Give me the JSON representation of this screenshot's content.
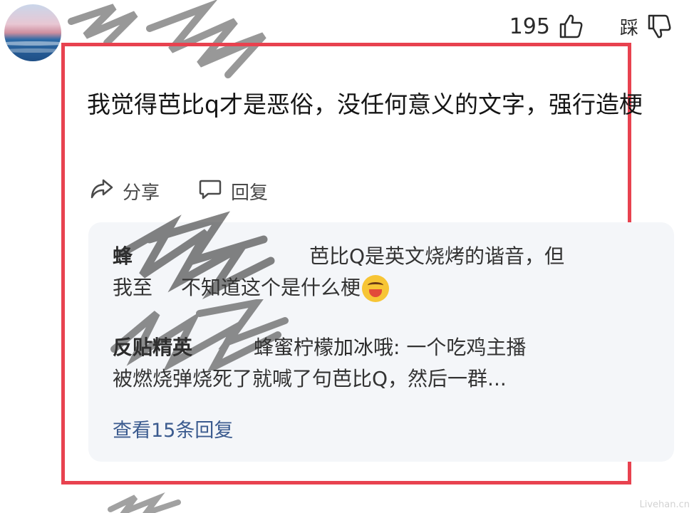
{
  "header": {
    "like_count": "195",
    "dislike_label": "踩"
  },
  "comment": {
    "text": "我觉得芭比q才是恶俗，没任何意义的文字，强行造梗"
  },
  "actions": {
    "share_label": "分享",
    "reply_label": "回复"
  },
  "replies": [
    {
      "nick": "蜂",
      "text_line1": "芭比Q是英文烧烤的谐音，但",
      "text_line2_a": "我至",
      "text_line2_b": "不知道这个是什么梗"
    },
    {
      "nick": "反贴精英",
      "reply_to": "蜂蜜柠檬加冰哦:",
      "text_line1": "一个吃鸡主播",
      "text_line2": "被燃烧弹烧死了就喊了句芭比Q，然后一群..."
    }
  ],
  "view_more_label": "查看15条回复",
  "watermark": "Livehan.cn",
  "colors": {
    "frame_border": "#e8424f",
    "reply_bg": "#f4f6f9",
    "link": "#3b5b8f"
  }
}
